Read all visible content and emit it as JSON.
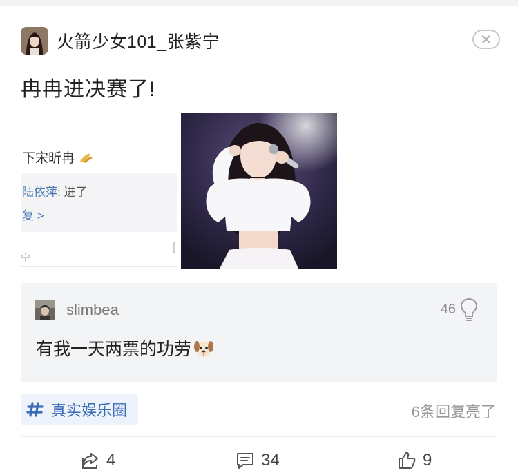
{
  "post": {
    "author": "火箭少女101_张紫宁",
    "text": "冉冉进决赛了!",
    "screenshot_image": {
      "line1": "下宋昕冉",
      "reply_name": "陆依萍",
      "reply_text": ": 进了",
      "more": "复 >",
      "bottom": "宁",
      "bracket": "["
    }
  },
  "comment": {
    "username": "slimbea",
    "likes": "46",
    "text": "有我一天两票的功劳"
  },
  "tag": {
    "label": "真实娱乐圈"
  },
  "reply_count": "6条回复亮了",
  "actions": {
    "share_count": "4",
    "comment_count": "34",
    "like_count": "9"
  },
  "icons": {
    "close": "close-icon",
    "hash": "hash-icon",
    "bulb": "lightbulb-icon",
    "share": "share-icon",
    "comment": "comment-icon",
    "like": "thumbs-up-icon",
    "dog": "dog-emoji-icon"
  },
  "colors": {
    "tag_text": "#3a6bb8",
    "tag_bg": "#eef3fb",
    "comment_bg": "#f3f4f6"
  }
}
